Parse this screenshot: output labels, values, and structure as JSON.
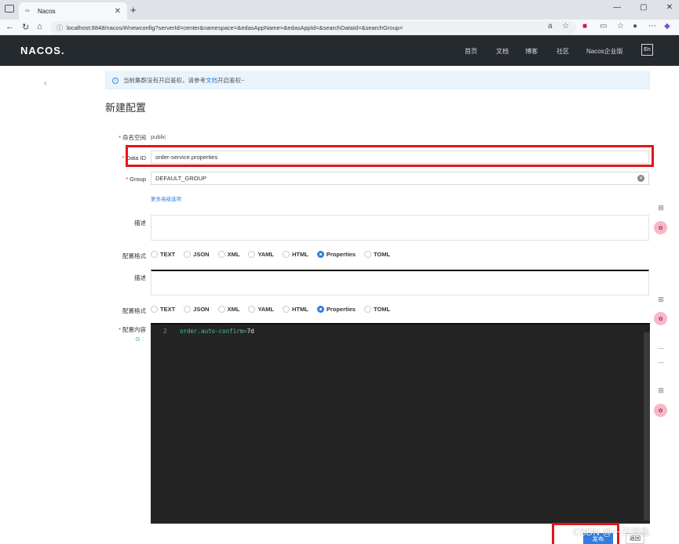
{
  "browser": {
    "tab_title": "Nacos",
    "url": "localhost:8848/nacos/#/newconfig?serverId=center&namespace=&edasAppName=&edasAppId=&searchDataId=&searchGroup="
  },
  "header": {
    "logo": "NACOS.",
    "nav": [
      "首页",
      "文档",
      "博客",
      "社区",
      "Nacos企业版"
    ],
    "lang": "En"
  },
  "notice": {
    "text_before": "当前集群没有开启鉴权，请参考",
    "link": "文档",
    "text_after": "开启鉴权~"
  },
  "page_title": "新建配置",
  "form": {
    "namespace_label": "命名空间",
    "namespace_value": "public",
    "dataid_label": "Data ID",
    "dataid_value": "order-service.properties",
    "group_label": "Group",
    "group_value": "DEFAULT_GROUP",
    "more_options": "更多高级选项",
    "desc_label": "描述",
    "format_label": "配置格式",
    "content_label": "配置内容",
    "formats": [
      "TEXT",
      "JSON",
      "XML",
      "YAML",
      "HTML",
      "Properties",
      "TOML"
    ],
    "selected_format": "Properties"
  },
  "editor": {
    "line_number": "2",
    "code_key": "order.auto-confirm=",
    "code_value": "7d"
  },
  "buttons": {
    "publish": "发布",
    "back": "返回"
  },
  "watermark": "CSDN @一只游鱼",
  "colors": {
    "accent": "#2f7de1",
    "header_bg": "#252a2f",
    "highlight_red": "#e5141a",
    "editor_bg": "#242424"
  }
}
